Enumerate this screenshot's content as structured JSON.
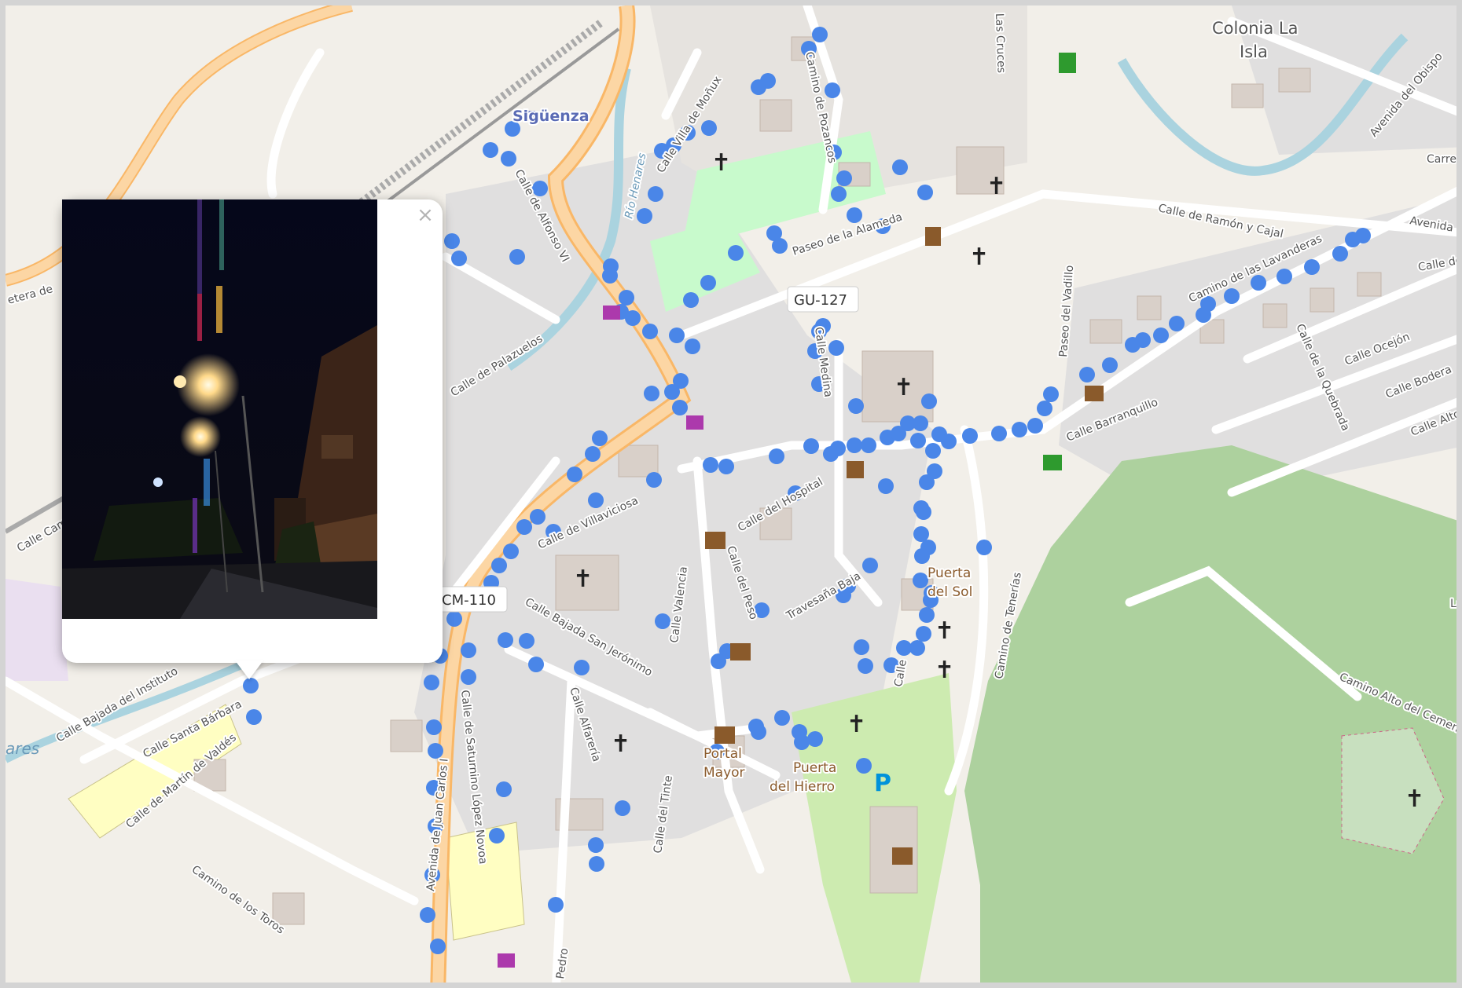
{
  "map": {
    "street_labels": [
      "Calle de Alfonso VI",
      "Río Henares",
      "Calle de Villaviciosa",
      "Calle del Hospital",
      "Calle Valencia",
      "Calle del Peso",
      "Travesaña Baja",
      "Calle Bajada San Jerónimo",
      "Calle Alfarería",
      "Calle del Tinte",
      "Calle de Saturnino López Novoa",
      "Avenida de Juan Carlos I",
      "Camino de los Toros",
      "Calle Santa Bárbara",
      "Calle de Martín de Valdés",
      "Calle Bajada del Instituto",
      "Calle de Ramón y Cajal",
      "Camino de las Lavanderas",
      "Calle Barranquillo",
      "Calle de la Quebrada",
      "Calle Ocejón",
      "Calle Bodera",
      "Camino de Tenerías",
      "Paseo del Vadillo",
      "Paseo de la Alameda",
      "Calle de Palazuelos",
      "Camino de Pozancos",
      "Avenida del Obispo",
      "Camino Alto del Cementerio",
      "Las Cruces",
      "Calle Medina",
      "Calle Alto Rey",
      "Pedro",
      "Calle Cam",
      "Avenida",
      "Calle de",
      "Carre",
      "La",
      "Calle",
      "Calle Villa de Moñux",
      "etera de"
    ],
    "place_labels": {
      "town": "Sigüenza",
      "colonia_1": "Colonia La",
      "colonia_2": "Isla",
      "puerta_sol_1": "Puerta",
      "puerta_sol_2": "del Sol",
      "portal_mayor_1": "Portal",
      "portal_mayor_2": "Mayor",
      "puerta_hierro_1": "Puerta",
      "puerta_hierro_2": "del Hierro",
      "river": "ares"
    },
    "road_shields": [
      "GU-127",
      "CM-110"
    ],
    "track_color": "#4a86e8",
    "water_color": "#aad3df",
    "park_color": "#add19e"
  },
  "popup": {
    "close_symbol": "×",
    "photo_icon": "night-street-photo"
  }
}
